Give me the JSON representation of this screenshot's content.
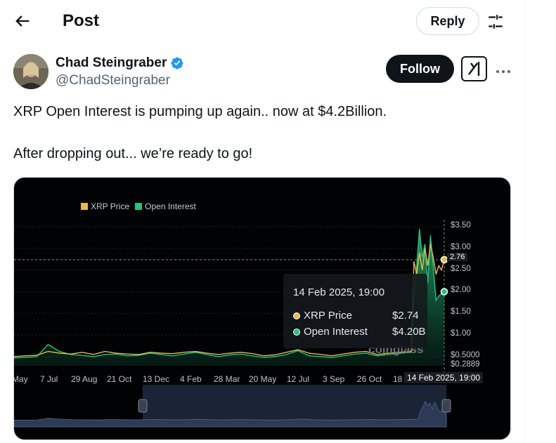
{
  "header": {
    "title": "Post",
    "reply_label": "Reply"
  },
  "author": {
    "name": "Chad Steingraber",
    "handle": "@ChadSteingraber",
    "follow_label": "Follow"
  },
  "post": {
    "line1": "XRP Open Interest is pumping up again.. now at $4.2Billion.",
    "line2": "After dropping out... we’re ready to go!"
  },
  "icons": {
    "back": "arrow-left-icon",
    "settings": "sliders-icon",
    "verified": "verified-badge-icon",
    "grok": "grok-icon",
    "more": "more-horizontal-icon"
  },
  "colors": {
    "accent_blue": "#1d9bf0",
    "xrp_price": "#e9b949",
    "open_interest": "#26c281"
  },
  "chart_data": {
    "type": "line",
    "legend": [
      {
        "name": "XRP Price",
        "color": "#e9b949"
      },
      {
        "name": "Open Interest",
        "color": "#26c281"
      }
    ],
    "legend_position": "top-left",
    "x_tick_labels": [
      "May",
      "7 Jul",
      "29 Aug",
      "21 Oct",
      "13 Dec",
      "4 Feb",
      "28 Mar",
      "20 May",
      "12 Jul",
      "3 Sep",
      "26 Oct",
      "18",
      "14 Feb 2025, 19:00"
    ],
    "y_tick_labels": [
      "$3.50",
      "$3.00",
      "2.76",
      "$2.50",
      "$2.00",
      "$1.50",
      "$1.00",
      "$0.5000",
      "$0.2889"
    ],
    "ylim": [
      0.2889,
      3.5
    ],
    "tooltip": {
      "date": "14 Feb 2025, 19:00",
      "rows": [
        {
          "label": "XRP Price",
          "value": "$2.74"
        },
        {
          "label": "Open Interest",
          "value": "$4.20B"
        }
      ]
    },
    "watermark": "coinglass",
    "series": [
      {
        "name": "XRP Price",
        "values": [
          0.5,
          0.52,
          0.53,
          0.62,
          0.58,
          0.56,
          0.6,
          0.55,
          0.62,
          0.58,
          0.56,
          0.55,
          0.6,
          0.58,
          0.57,
          0.6,
          0.62,
          0.58,
          0.55,
          0.58,
          0.6,
          0.57,
          0.52,
          0.54,
          0.6,
          0.66,
          0.58,
          0.55,
          0.52,
          0.56,
          0.6,
          0.62,
          0.55,
          0.58,
          0.6,
          0.62,
          2.7,
          2.4,
          2.9,
          2.5,
          3.0,
          2.6,
          3.1,
          2.8,
          2.4,
          2.6,
          2.5,
          2.74
        ]
      },
      {
        "name": "Open Interest",
        "values": [
          0.47,
          0.48,
          0.5,
          0.78,
          0.62,
          0.55,
          0.53,
          0.5,
          0.55,
          0.56,
          0.52,
          0.53,
          0.58,
          0.55,
          0.52,
          0.56,
          0.6,
          0.55,
          0.5,
          0.54,
          0.56,
          0.52,
          0.48,
          0.5,
          0.55,
          0.64,
          0.52,
          0.5,
          0.48,
          0.52,
          0.56,
          0.58,
          0.52,
          0.55,
          0.58,
          0.6,
          1.9,
          2.6,
          3.45,
          2.8,
          3.1,
          2.2,
          3.3,
          2.6,
          1.8,
          1.9,
          1.95,
          2.0
        ]
      }
    ]
  }
}
